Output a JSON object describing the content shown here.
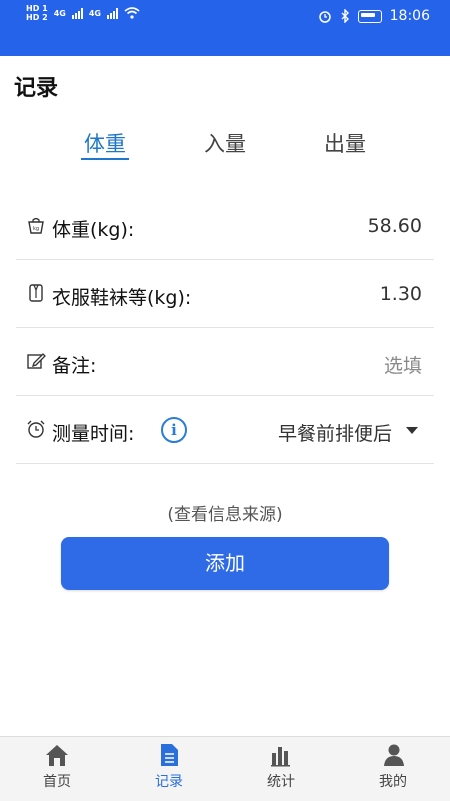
{
  "status_bar": {
    "left": {
      "hd1": "HD 1",
      "hd2": "HD 2",
      "net1": "4G",
      "net2": "4G"
    },
    "time": "18:06"
  },
  "header": {
    "title": "记录"
  },
  "tabs": [
    {
      "label": "体重",
      "active": true
    },
    {
      "label": "入量",
      "active": false
    },
    {
      "label": "出量",
      "active": false
    }
  ],
  "form": {
    "weight": {
      "label": "体重(kg):",
      "value": "58.60",
      "icon": "scale-icon"
    },
    "clothes": {
      "label": "衣服鞋袜等(kg):",
      "value": "1.30",
      "icon": "clothes-icon"
    },
    "note": {
      "label": "备注:",
      "placeholder": "选填",
      "icon": "edit-icon"
    },
    "time": {
      "label": "测量时间:",
      "value": "早餐前排便后",
      "icon": "alarm-icon"
    }
  },
  "info_source": "(查看信息来源)",
  "add_button": "添加",
  "bottom_nav": [
    {
      "label": "首页",
      "icon": "home-icon",
      "active": false
    },
    {
      "label": "记录",
      "icon": "document-icon",
      "active": true
    },
    {
      "label": "统计",
      "icon": "bar-chart-icon",
      "active": false
    },
    {
      "label": "我的",
      "icon": "user-icon",
      "active": false
    }
  ],
  "colors": {
    "primary": "#2563eb",
    "accent": "#1e77c9",
    "button": "#2f6be6"
  }
}
